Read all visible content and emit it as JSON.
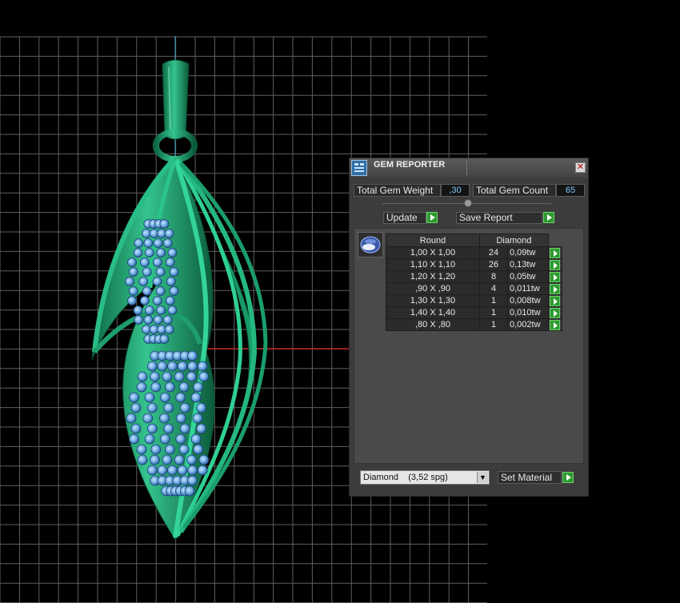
{
  "colors": {
    "background": "#000000",
    "grid": "#5f5f5f",
    "pendant_green": "#1fa672",
    "gem_blue": "#6fb0e6",
    "accent_green": "#2f9a2f",
    "value_text": "#7ec8ff"
  },
  "panel": {
    "title": "GEM REPORTER",
    "title_icon": "gem-reporter-icon",
    "close_icon": "close-icon",
    "total_weight_label": "Total Gem Weight",
    "total_weight_value": ",30",
    "total_count_label": "Total Gem Count",
    "total_count_value": "65",
    "update_label": "Update",
    "save_report_label": "Save Report",
    "gem_shape_icon": "round-gem-icon",
    "table": {
      "headers": [
        "Round",
        "Diamond"
      ],
      "rows": [
        {
          "size": "1,00 X 1,00",
          "count": "24",
          "weight": "0,09tw"
        },
        {
          "size": "1,10 X 1,10",
          "count": "26",
          "weight": "0,13tw"
        },
        {
          "size": "1,20 X 1,20",
          "count": "8",
          "weight": "0,05tw"
        },
        {
          "size": ",90 X ,90",
          "count": "4",
          "weight": "0,011tw"
        },
        {
          "size": "1,30 X 1,30",
          "count": "1",
          "weight": "0,008tw"
        },
        {
          "size": "1,40 X 1,40",
          "count": "1",
          "weight": "0,010tw"
        },
        {
          "size": ",80 X ,80",
          "count": "1",
          "weight": "0,002tw"
        }
      ]
    },
    "material_selected": "Diamond    (3,52 spg)",
    "set_material_label": "Set Material"
  }
}
